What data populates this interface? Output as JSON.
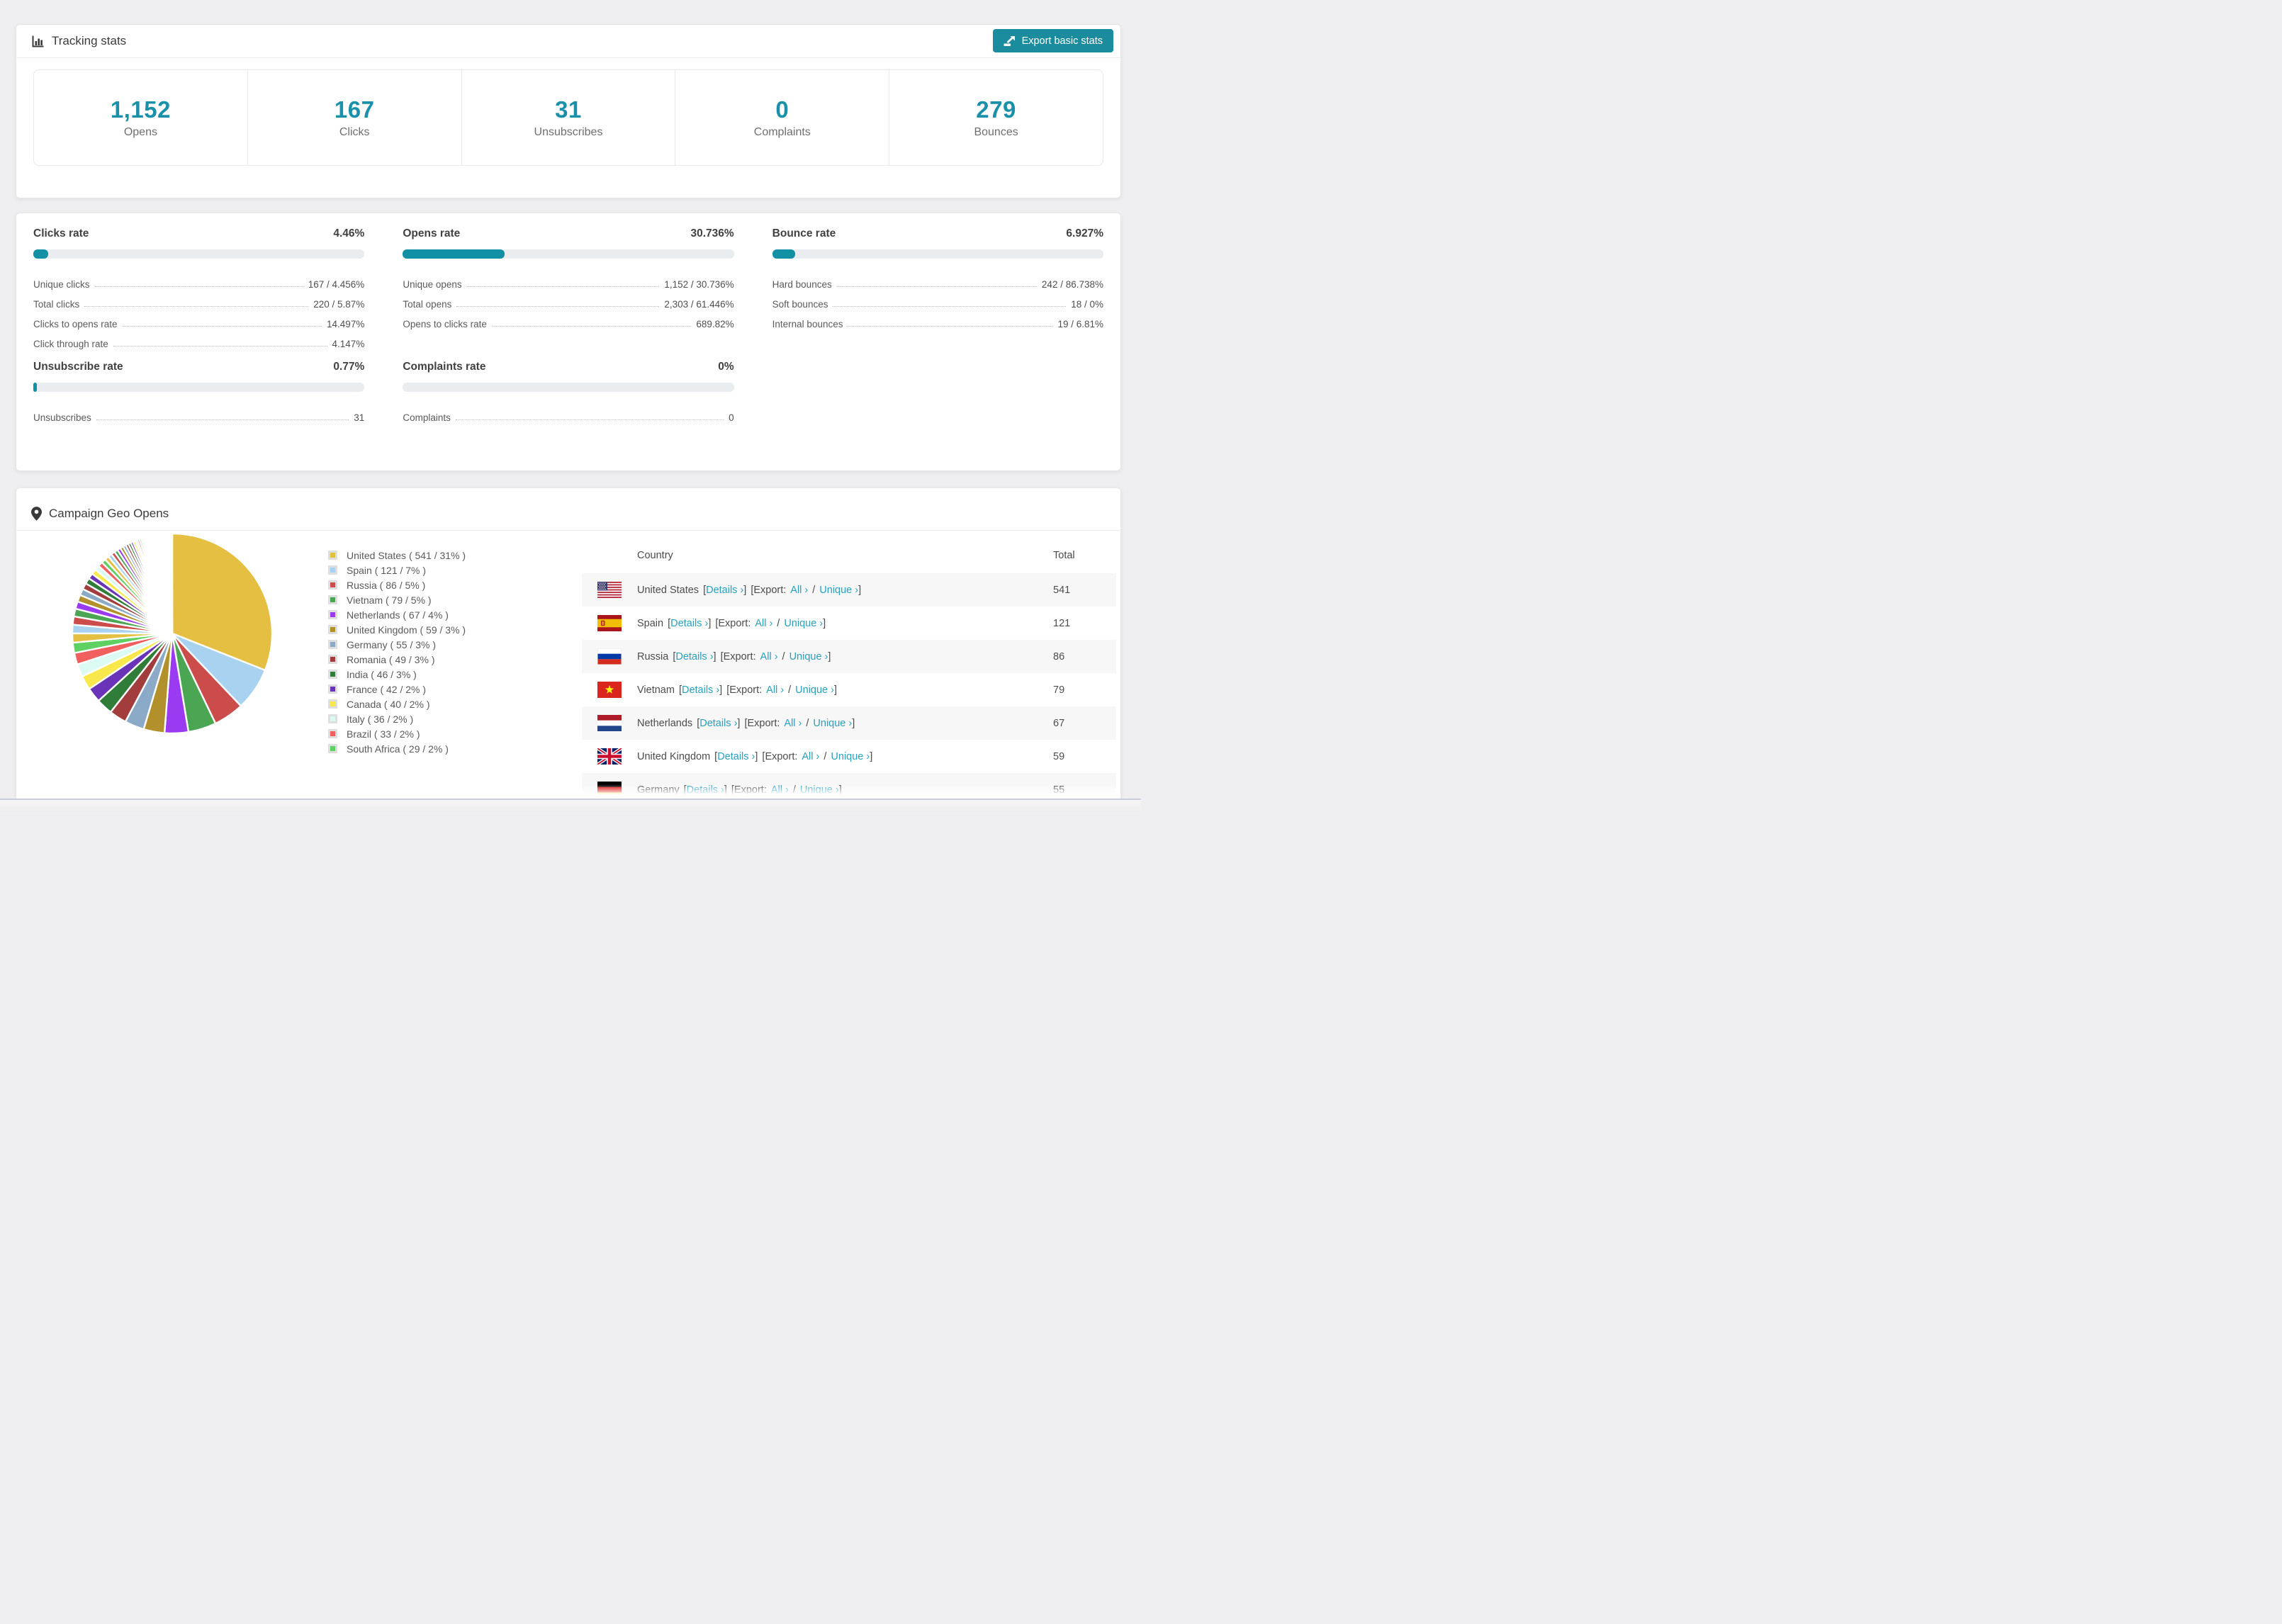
{
  "colors": {
    "accent": "#1a90a9",
    "button": "#1b8c9e",
    "link": "#2aa0bf",
    "bar_bg": "#eaedf0"
  },
  "tracking": {
    "title": "Tracking stats",
    "export_label": "Export basic stats",
    "stats": [
      {
        "value": "1,152",
        "label": "Opens"
      },
      {
        "value": "167",
        "label": "Clicks"
      },
      {
        "value": "31",
        "label": "Unsubscribes"
      },
      {
        "value": "0",
        "label": "Complaints"
      },
      {
        "value": "279",
        "label": "Bounces"
      }
    ]
  },
  "rates": [
    {
      "title": "Clicks rate",
      "percent": "4.46%",
      "bar_fraction": 4.46,
      "rows": [
        {
          "label": "Unique clicks",
          "value": "167 / 4.456%"
        },
        {
          "label": "Total clicks",
          "value": "220 / 5.87%"
        },
        {
          "label": "Clicks to opens rate",
          "value": "14.497%"
        },
        {
          "label": "Click through rate",
          "value": "4.147%"
        }
      ]
    },
    {
      "title": "Opens rate",
      "percent": "30.736%",
      "bar_fraction": 30.736,
      "rows": [
        {
          "label": "Unique opens",
          "value": "1,152 / 30.736%"
        },
        {
          "label": "Total opens",
          "value": "2,303 / 61.446%"
        },
        {
          "label": "Opens to clicks rate",
          "value": "689.82%"
        }
      ]
    },
    {
      "title": "Bounce rate",
      "percent": "6.927%",
      "bar_fraction": 6.927,
      "rows": [
        {
          "label": "Hard bounces",
          "value": "242 / 86.738%"
        },
        {
          "label": "Soft bounces",
          "value": "18 / 0%"
        },
        {
          "label": "Internal bounces",
          "value": "19 / 6.81%"
        }
      ]
    },
    {
      "title": "Unsubscribe rate",
      "percent": "0.77%",
      "bar_fraction": 0.77,
      "rows": [
        {
          "label": "Unsubscribes",
          "value": "31"
        }
      ]
    },
    {
      "title": "Complaints rate",
      "percent": "0%",
      "bar_fraction": 0,
      "rows": [
        {
          "label": "Complaints",
          "value": "0"
        }
      ]
    }
  ],
  "geo": {
    "title": "Campaign Geo Opens",
    "legend": [
      {
        "label": "United States ( 541 / 31% )",
        "color": "#e5bf41"
      },
      {
        "label": "Spain ( 121 / 7% )",
        "color": "#a8d2f0"
      },
      {
        "label": "Russia ( 86 / 5% )",
        "color": "#cc4b4b"
      },
      {
        "label": "Vietnam ( 79 / 5% )",
        "color": "#4ba653"
      },
      {
        "label": "Netherlands ( 67 / 4% )",
        "color": "#9a3bf2"
      },
      {
        "label": "United Kingdom ( 59 / 3% )",
        "color": "#b2912c"
      },
      {
        "label": "Germany ( 55 / 3% )",
        "color": "#8aaac7"
      },
      {
        "label": "Romania ( 49 / 3% )",
        "color": "#a33d3d"
      },
      {
        "label": "India ( 46 / 3% )",
        "color": "#2f7d38"
      },
      {
        "label": "France ( 42 / 2% )",
        "color": "#6a34b8"
      },
      {
        "label": "Canada ( 40 / 2% )",
        "color": "#f8e84b"
      },
      {
        "label": "Italy ( 36 / 2% )",
        "color": "#dbfaf3"
      },
      {
        "label": "Brazil ( 33 / 2% )",
        "color": "#f25f5f"
      },
      {
        "label": "South Africa ( 29 / 2% )",
        "color": "#5fd062"
      }
    ],
    "table": {
      "headers": [
        "Country",
        "Total"
      ],
      "links": {
        "bracket_open": "[",
        "bracket_close": "]",
        "details": "Details ›",
        "export_prefix": "[Export:",
        "all": "All ›",
        "slash": "/",
        "unique": "Unique ›"
      },
      "rows": [
        {
          "country": "United States",
          "flag": "us",
          "total": "541"
        },
        {
          "country": "Spain",
          "flag": "es",
          "total": "121"
        },
        {
          "country": "Russia",
          "flag": "ru",
          "total": "86"
        },
        {
          "country": "Vietnam",
          "flag": "vn",
          "total": "79"
        },
        {
          "country": "Netherlands",
          "flag": "nl",
          "total": "67"
        },
        {
          "country": "United Kingdom",
          "flag": "gb",
          "total": "59"
        },
        {
          "country": "Germany",
          "flag": "de",
          "total": "55",
          "clipped": true
        }
      ]
    }
  },
  "chart_data": {
    "type": "pie",
    "title": "Campaign Geo Opens",
    "labels": [
      "United States",
      "Spain",
      "Russia",
      "Vietnam",
      "Netherlands",
      "United Kingdom",
      "Germany",
      "Romania",
      "India",
      "France",
      "Canada",
      "Italy",
      "Brazil",
      "South Africa"
    ],
    "values": [
      541,
      121,
      86,
      79,
      67,
      59,
      55,
      49,
      46,
      42,
      40,
      36,
      33,
      29
    ],
    "percents": [
      31,
      7,
      5,
      5,
      4,
      3,
      3,
      3,
      3,
      2,
      2,
      2,
      2,
      2
    ],
    "colors": [
      "#e5bf41",
      "#a8d2f0",
      "#cc4b4b",
      "#4ba653",
      "#9a3bf2",
      "#b2912c",
      "#8aaac7",
      "#a33d3d",
      "#2f7d38",
      "#6a34b8",
      "#f8e84b",
      "#dbfaf3",
      "#f25f5f",
      "#5fd062"
    ],
    "others_estimated_total": 462,
    "start_angle": 0,
    "direction": "clockwise",
    "legend_position": "right",
    "grid": false
  }
}
